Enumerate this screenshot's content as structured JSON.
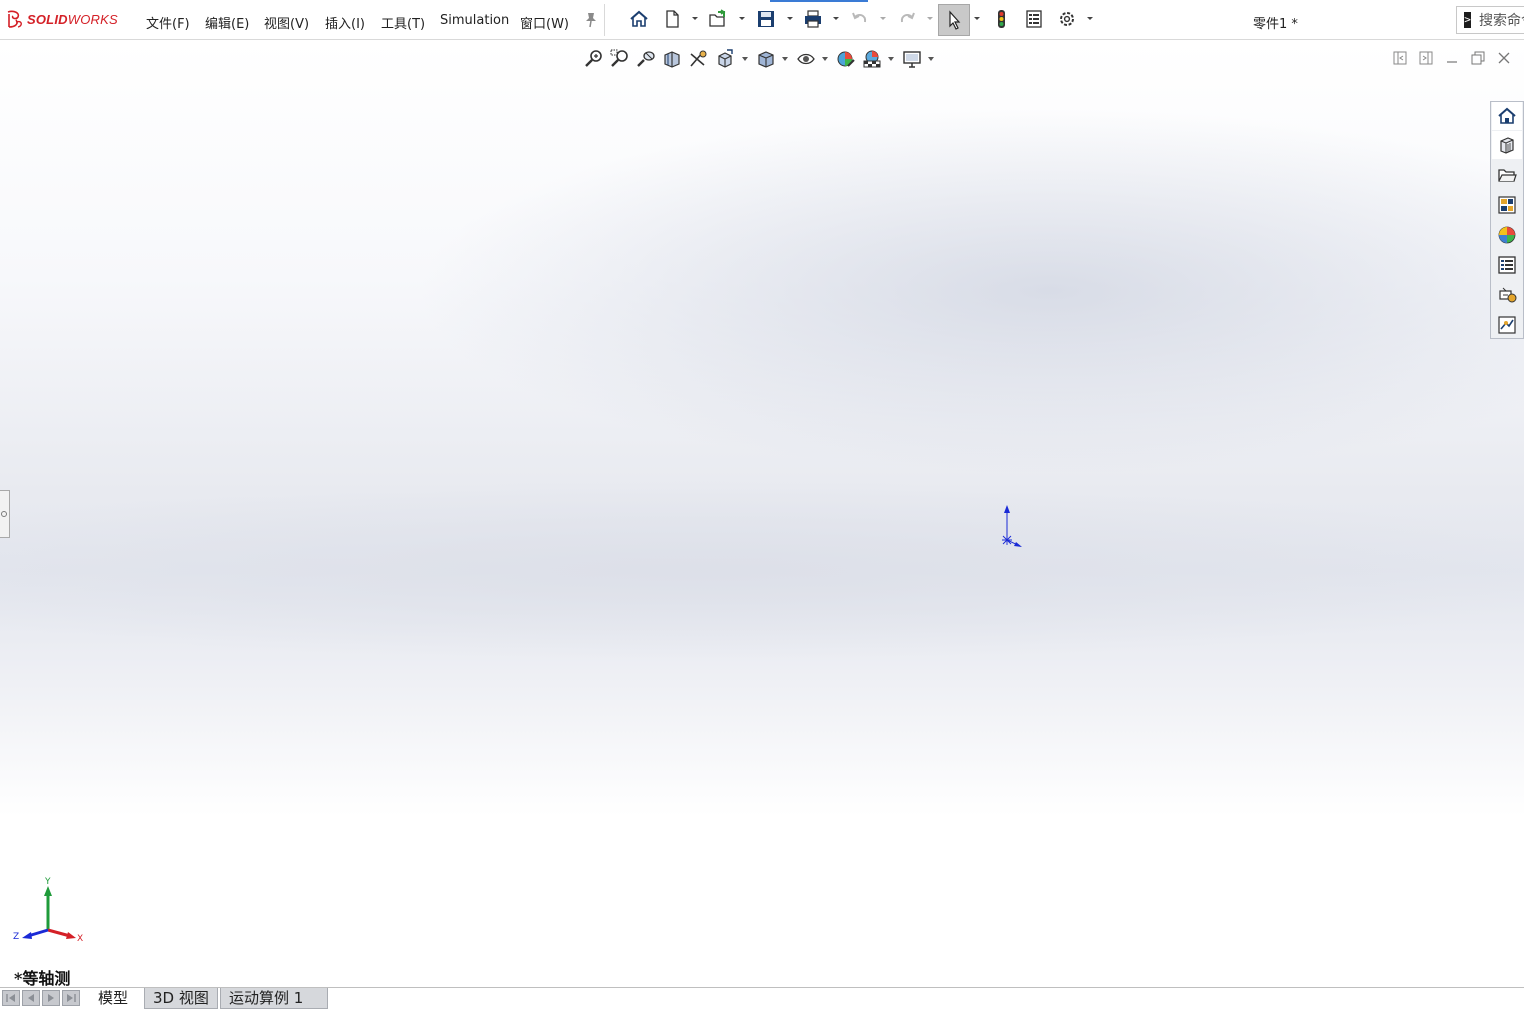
{
  "app": {
    "brand_bold": "SOLID",
    "brand_light": "WORKS",
    "document_title": "零件1 *"
  },
  "menu": {
    "items": [
      {
        "label": "文件(F)"
      },
      {
        "label": "编辑(E)"
      },
      {
        "label": "视图(V)"
      },
      {
        "label": "插入(I)"
      },
      {
        "label": "工具(T)"
      },
      {
        "label": "Simulation"
      },
      {
        "label": "窗口(W)"
      }
    ]
  },
  "toolbar": {
    "buttons": [
      "home-icon",
      "new-document-icon",
      "open-icon",
      "save-icon",
      "print-icon",
      "undo-icon",
      "redo-icon",
      "select-icon",
      "rebuild-icon",
      "file-properties-icon",
      "options-icon"
    ]
  },
  "search": {
    "placeholder": "搜索命令"
  },
  "heads_up_toolbar": {
    "buttons": [
      "zoom-to-fit-icon",
      "zoom-to-area-icon",
      "previous-view-icon",
      "section-view-icon",
      "dynamic-annotation-icon",
      "view-orientation-icon",
      "display-style-icon",
      "hide-show-items-icon",
      "edit-appearance-icon",
      "apply-scene-icon",
      "view-settings-icon"
    ]
  },
  "task_pane": {
    "items": [
      "solidworks-resources-icon",
      "design-library-icon",
      "file-explorer-icon",
      "view-palette-icon",
      "appearances-scenes-icon",
      "custom-properties-icon",
      "solidworks-forum-icon",
      "simulation-icon"
    ]
  },
  "triad": {
    "x_label": "X",
    "y_label": "Y",
    "z_label": "Z"
  },
  "viewport": {
    "view_orientation": "*等轴测"
  },
  "bottom_tabs": [
    {
      "label": "模型",
      "active": true
    },
    {
      "label": "3D 视图",
      "active": false
    },
    {
      "label": "运动算例 1",
      "active": false
    }
  ],
  "colors": {
    "brand_red": "#d42027",
    "origin_blue": "#1a2ad6",
    "axis_x_red": "#d42027",
    "axis_y_green": "#1f9b3a",
    "axis_z_blue": "#1a2ad6"
  }
}
